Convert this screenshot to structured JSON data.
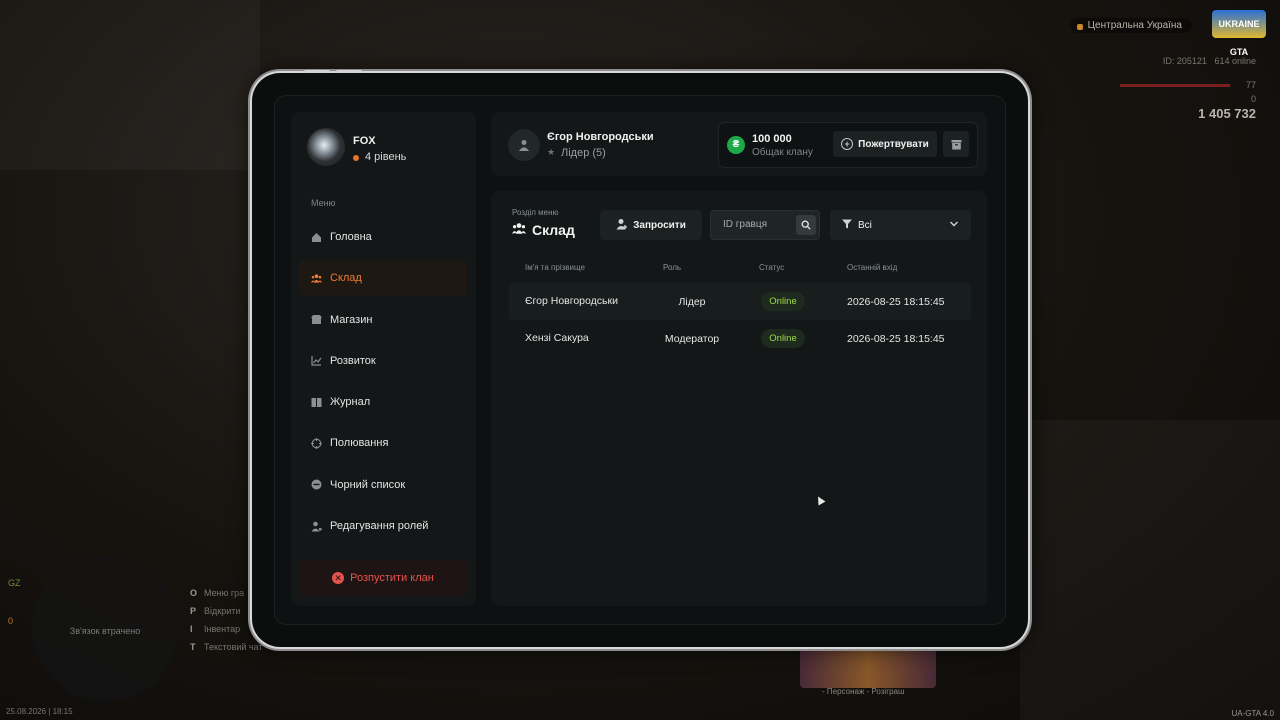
{
  "hud": {
    "region": "Центральна Україна",
    "server_logo": "UKRAINE GTA",
    "player_id": "ID: 205121",
    "online": "614 online",
    "health": "77",
    "armor": "0",
    "money": "1 405 732",
    "gz_label": "GZ",
    "gz_count": "0",
    "minimap_text": "Зв'язок втрачено",
    "date": "25.08.2026 | 18:15",
    "version": "UA-GTA 4.0",
    "banner_text": "- Персонаж - Розіграш",
    "keys": [
      {
        "key": "O",
        "label": "Меню гра"
      },
      {
        "key": "P",
        "label": "Відкрити"
      },
      {
        "key": "I",
        "label": "Інвентар"
      },
      {
        "key": "T",
        "label": "Текстовий чат"
      }
    ]
  },
  "clan": {
    "name": "FOX",
    "level": "4 рівень"
  },
  "sidebar": {
    "caption": "Меню",
    "items": [
      {
        "label": "Головна",
        "icon": "home-icon",
        "active": false
      },
      {
        "label": "Склад",
        "icon": "members-icon",
        "active": true
      },
      {
        "label": "Магазин",
        "icon": "shop-icon",
        "active": false
      },
      {
        "label": "Розвиток",
        "icon": "growth-chart-icon",
        "active": false
      },
      {
        "label": "Журнал",
        "icon": "journal-icon",
        "active": false
      },
      {
        "label": "Полювання",
        "icon": "crosshair-icon",
        "active": false
      },
      {
        "label": "Чорний список",
        "icon": "blacklist-icon",
        "active": false
      },
      {
        "label": "Редагування ролей",
        "icon": "role-edit-icon",
        "active": false
      }
    ],
    "disband_label": "Розпустити клан"
  },
  "header": {
    "leader_name": "Єгор Новгородськи",
    "leader_role": "Лідер (5)",
    "money_value": "100 000",
    "money_caption": "Общак клану",
    "donate_label": "Пожертвувати"
  },
  "main": {
    "section_caption": "Розділ меню",
    "section_title": "Склад",
    "invite_label": "Запросити",
    "search_placeholder": "ID гравця",
    "filter_value": "Всі",
    "columns": [
      "Ім'я та прізвище",
      "Роль",
      "Статус",
      "Останній вхід"
    ],
    "rows": [
      {
        "name": "Єгор Новгородськи",
        "role": "Лідер",
        "status": "Online",
        "last": "2026-08-25 18:15:45"
      },
      {
        "name": "Хензі Сакура",
        "role": "Модератор",
        "status": "Online",
        "last": "2026-08-25 18:15:45"
      }
    ]
  },
  "colors": {
    "accent": "#ef7a33",
    "online": "#9fdc4a",
    "danger": "#e5534d",
    "coin": "#1fa84a"
  }
}
